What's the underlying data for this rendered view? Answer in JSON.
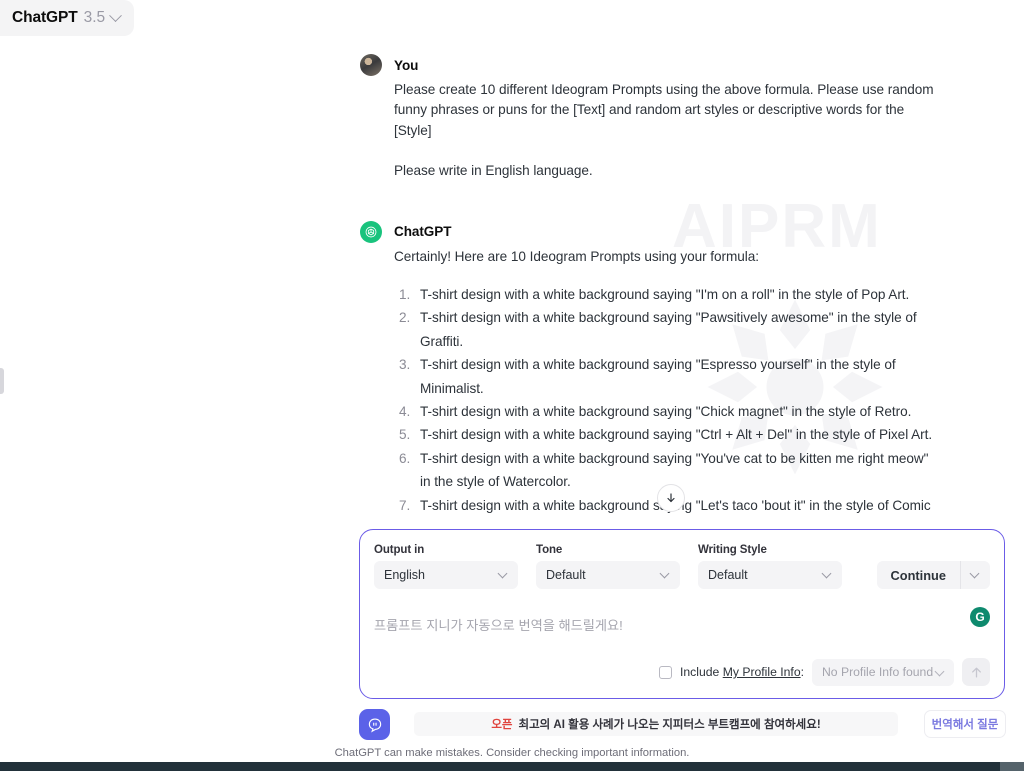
{
  "model_switcher": {
    "name": "ChatGPT",
    "version": "3.5",
    "chevron_icon": "chevron-down-icon"
  },
  "conversation": {
    "user": {
      "author": "You",
      "avatar_icon": "user-avatar",
      "paragraphs": [
        "Please create 10 different Ideogram Prompts using the above formula. Please use random funny phrases or puns for the [Text] and random art styles or descriptive words for the [Style]",
        "Please write in English language."
      ]
    },
    "assistant": {
      "author": "ChatGPT",
      "avatar_icon": "openai-logo-icon",
      "intro": "Certainly! Here are 10 Ideogram Prompts using your formula:",
      "items": [
        "T-shirt design with a white background saying \"I'm on a roll\" in the style of Pop Art.",
        "T-shirt design with a white background saying \"Pawsitively awesome\" in the style of Graffiti.",
        "T-shirt design with a white background saying \"Espresso yourself\" in the style of Minimalist.",
        "T-shirt design with a white background saying \"Chick magnet\" in the style of Retro.",
        "T-shirt design with a white background saying \"Ctrl + Alt + Del\" in the style of Pixel Art.",
        "T-shirt design with a white background saying \"You've cat to be kitten me right meow\" in the style of Watercolor.",
        "T-shirt design with a white background saying \"Let's taco 'bout it\" in the style of Comic"
      ]
    },
    "watermark": "AIPRM",
    "scroll_button_icon": "arrow-down-icon"
  },
  "composer": {
    "controls": [
      {
        "label": "Output in",
        "value": "English",
        "chevron_icon": "chevron-down-icon"
      },
      {
        "label": "Tone",
        "value": "Default",
        "chevron_icon": "chevron-down-icon"
      },
      {
        "label": "Writing Style",
        "value": "Default",
        "chevron_icon": "chevron-down-icon"
      }
    ],
    "continue": {
      "label": "Continue",
      "chevron_icon": "chevron-down-icon"
    },
    "input_placeholder": "프롬프트 지니가 자동으로 번역을 해드릴게요!",
    "refresh_icon": "genie-refresh-icon",
    "profile": {
      "checkbox_icon": "checkbox-unchecked-icon",
      "label_prefix": "Include ",
      "label_link": "My Profile Info",
      "label_suffix": ":",
      "select_value": "No Profile Info found",
      "chevron_icon": "chevron-down-icon"
    },
    "send_icon": "arrow-up-icon",
    "border_color": "#6b5ce7"
  },
  "bottom_bar": {
    "launcher_icon": "genie-ghost-icon",
    "launcher_color": "#5b62e8",
    "promo_tag": "오픈",
    "promo_text": "최고의 AI 활용 사례가 나오는 지피터스 부트캠프에 참여하세요!",
    "translate_button": "번역해서 질문",
    "disclaimer": "ChatGPT can make mistakes. Consider checking important information."
  }
}
